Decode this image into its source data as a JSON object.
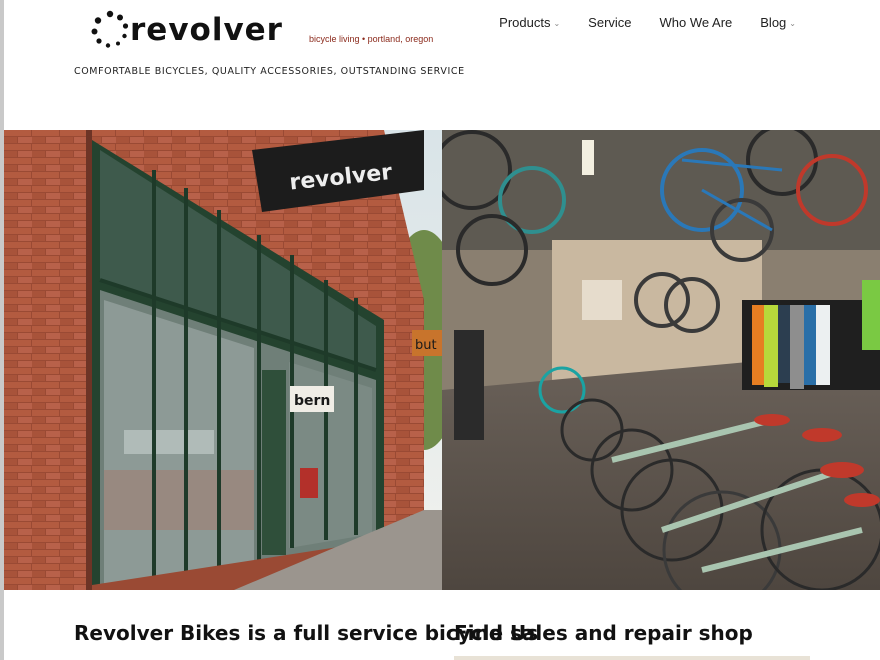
{
  "brand": {
    "name": "revolver",
    "tagline_small": "bicycle living  •  portland, oregon",
    "tagline": "COMFORTABLE BICYCLES, QUALITY ACCESSORIES, OUTSTANDING SERVICE"
  },
  "nav": {
    "items": [
      {
        "label": "Products",
        "has_dropdown": true
      },
      {
        "label": "Service",
        "has_dropdown": false
      },
      {
        "label": "Who We Are",
        "has_dropdown": false
      },
      {
        "label": "Blog",
        "has_dropdown": true
      }
    ],
    "chevron": "⌄"
  },
  "hero": {
    "storefront_sign": "revolver",
    "storefront_poster": "bern",
    "storefront_side_sign": "but"
  },
  "main": {
    "heading": "Revolver Bikes is a full service bicycle sales and repair shop"
  },
  "sidebar": {
    "heading": "Find Us"
  },
  "colors": {
    "brand_red": "#8b2a1c",
    "text": "#222222"
  }
}
